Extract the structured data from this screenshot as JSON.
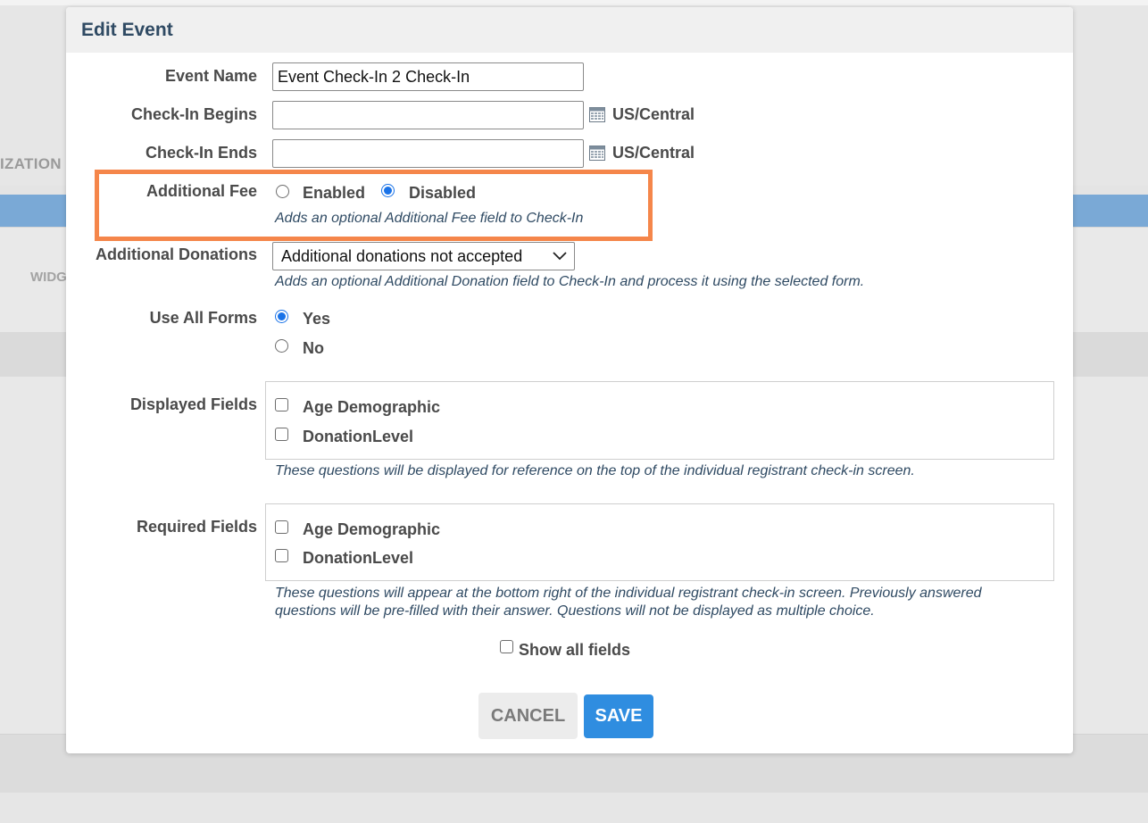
{
  "background": {
    "partial_label_1": "IZATION",
    "partial_label_2": "WIDG"
  },
  "modal": {
    "title": "Edit Event",
    "event_name": {
      "label": "Event Name",
      "value": "Event Check-In 2 Check-In"
    },
    "checkin_begins": {
      "label": "Check-In Begins",
      "value": "",
      "timezone": "US/Central"
    },
    "checkin_ends": {
      "label": "Check-In Ends",
      "value": "",
      "timezone": "US/Central"
    },
    "additional_fee": {
      "label": "Additional Fee",
      "options": [
        "Enabled",
        "Disabled"
      ],
      "selected": "Disabled",
      "help": "Adds an optional Additional Fee field to Check-In"
    },
    "additional_donations": {
      "label": "Additional Donations",
      "selected": "Additional donations not accepted",
      "help": "Adds an optional Additional Donation field to Check-In and process it using the selected form."
    },
    "use_all_forms": {
      "label": "Use All Forms",
      "options": [
        "Yes",
        "No"
      ],
      "selected": "Yes"
    },
    "displayed_fields": {
      "label": "Displayed Fields",
      "items": [
        "Age Demographic",
        "DonationLevel"
      ],
      "help": "These questions will be displayed for reference on the top of the individual registrant check-in screen."
    },
    "required_fields": {
      "label": "Required Fields",
      "items": [
        "Age Demographic",
        "DonationLevel"
      ],
      "help_line1": "These questions will appear at the bottom right of the individual registrant check-in screen. Previously answered",
      "help_line2": "questions will be pre-filled with their answer. Questions will not be displayed as multiple choice."
    },
    "show_all_fields": "Show all fields",
    "buttons": {
      "cancel": "CANCEL",
      "save": "SAVE"
    }
  },
  "colors": {
    "highlight_border": "#f5864a",
    "primary_button": "#2f8de0",
    "title_text": "#2f4a63",
    "radio_selected": "#1a73e8",
    "background_band": "#7aa9d6"
  },
  "icons": {
    "calendar": "calendar-icon",
    "dropdown": "chevron-down-icon"
  }
}
